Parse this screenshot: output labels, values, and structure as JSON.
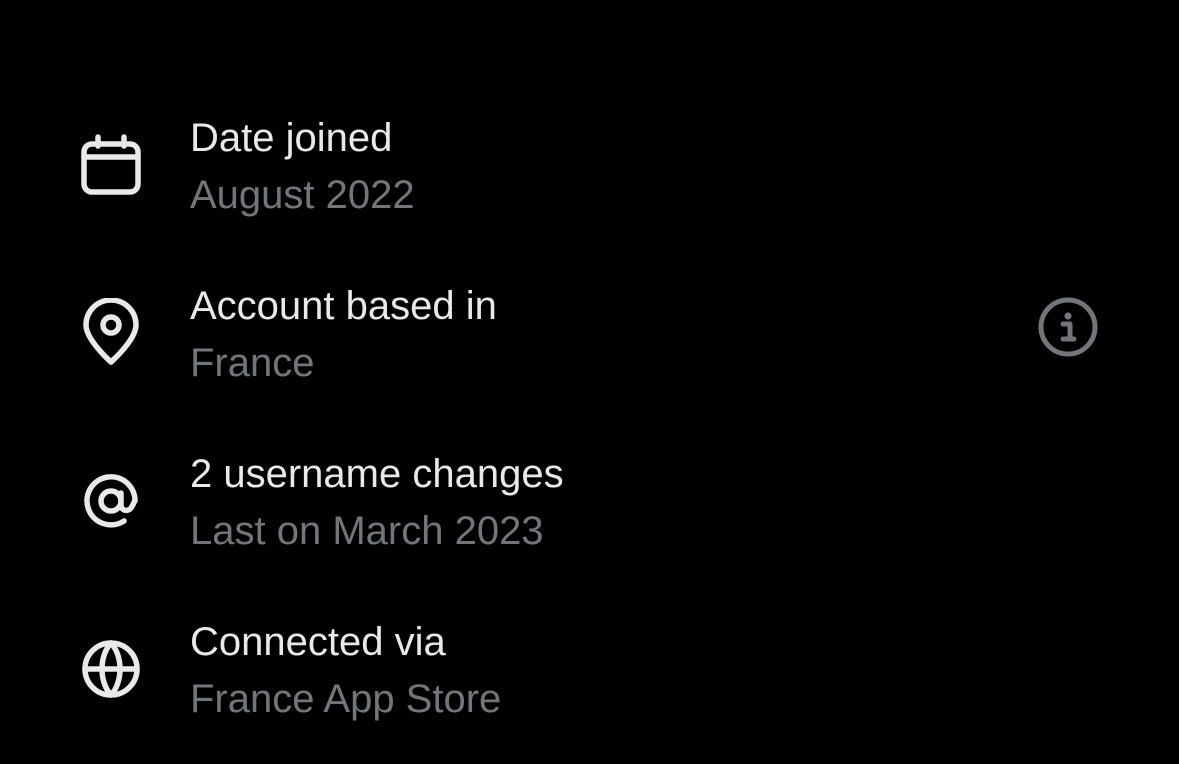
{
  "colors": {
    "background": "#000000",
    "primary_text": "#e7e9ea",
    "secondary_text": "#71767b",
    "icon": "#e7e9ea",
    "info_icon": "#71767b"
  },
  "rows": [
    {
      "icon": "calendar-icon",
      "title": "Date joined",
      "subtitle": "August 2022"
    },
    {
      "icon": "location-pin-icon",
      "title": "Account based in",
      "subtitle": "France",
      "trailing_icon": "info-icon"
    },
    {
      "icon": "at-sign-icon",
      "title": "2 username changes",
      "subtitle": "Last on March 2023"
    },
    {
      "icon": "globe-icon",
      "title": "Connected via",
      "subtitle": "France App Store"
    }
  ]
}
